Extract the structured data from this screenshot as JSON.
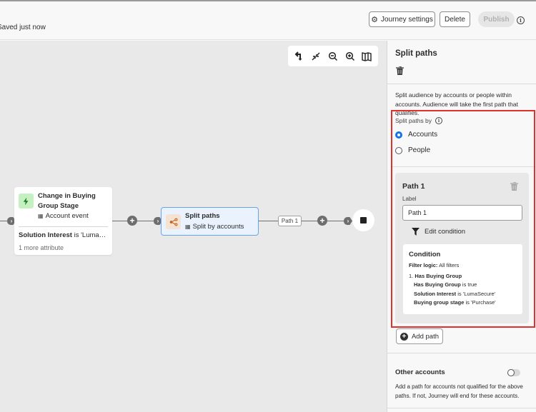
{
  "header": {
    "save_status": "Saved just now",
    "journey_settings_label": "Journey settings",
    "delete_label": "Delete",
    "publish_label": "Publish",
    "publish_enabled": false,
    "info_glyph": "i"
  },
  "canvas": {
    "toolbar": [
      {
        "name": "reorient-icon",
        "label": "Reorient"
      },
      {
        "name": "fit-to-screen-icon",
        "label": "Fit to screen"
      },
      {
        "name": "zoom-out-icon",
        "label": "Zoom out"
      },
      {
        "name": "zoom-in-icon",
        "label": "Zoom in"
      },
      {
        "name": "minimap-icon",
        "label": "Minimap"
      }
    ],
    "event_node": {
      "title_line1": "Change in Buying",
      "title_line2": "Group Stage",
      "type": "Account event",
      "attr_name": "Solution Interest",
      "attr_rest": " is 'LumaSec...",
      "more": "1 more attribute",
      "icon": "lightning-icon"
    },
    "split_node": {
      "title": "Split paths",
      "subtitle": "Split by accounts",
      "icon": "split-icon"
    },
    "path_label": "Path 1",
    "plus_glyph": "+",
    "chevron_glyph": "›"
  },
  "panel": {
    "title": "Split paths",
    "description": "Split audience by accounts or people within accounts. Audience will take the first path that qualifies.",
    "split_by_label": "Split paths by",
    "options": [
      {
        "label": "Accounts",
        "selected": true
      },
      {
        "label": "People",
        "selected": false
      }
    ],
    "path": {
      "title": "Path 1",
      "label_field_label": "Label",
      "label_value": "Path 1",
      "edit_condition_label": "Edit condition",
      "condition": {
        "title": "Condition",
        "filter_logic_key": "Filter logic:",
        "filter_logic_value": " All filters",
        "group_number": "1.",
        "group_name": "Has Buying Group",
        "rules": [
          {
            "field": "Has Buying Group",
            "op": " is true"
          },
          {
            "field": "Solution Interest",
            "op": " is 'LumaSecure'"
          },
          {
            "field": "Buying group stage",
            "op": " is 'Purchase'"
          }
        ]
      }
    },
    "add_path_label": "Add path",
    "other_accounts": {
      "title": "Other accounts",
      "enabled": false,
      "description": "Add a path for accounts not qualified for the above paths. If not, Journey will end for these accounts."
    }
  },
  "colors": {
    "accent": "#1473e6",
    "highlight_border": "#e0302b",
    "split_node_bg": "#e9f2fd",
    "event_icon_bg": "#c5f0c0",
    "split_icon_bg": "#f4e3d2"
  }
}
